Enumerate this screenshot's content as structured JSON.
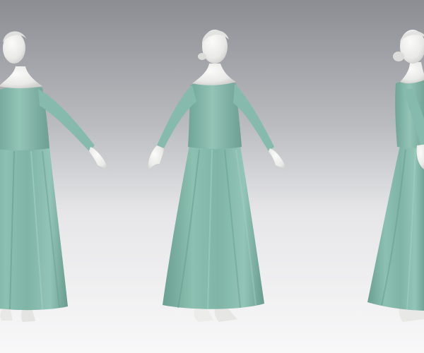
{
  "scene": {
    "description_free": true,
    "figures": [
      {
        "view": "front-three-quarter"
      },
      {
        "view": "front-three-quarter-right"
      },
      {
        "view": "side"
      }
    ],
    "colors": {
      "background_top": "#8d8f95",
      "background_bottom": "#f7f7f8",
      "dress_light": "#93c3b5",
      "dress_mid": "#7fb3a5",
      "dress_dark": "#5f9587",
      "skin_light": "#f4f4f3",
      "skin_shade": "#d2d2d0"
    }
  }
}
